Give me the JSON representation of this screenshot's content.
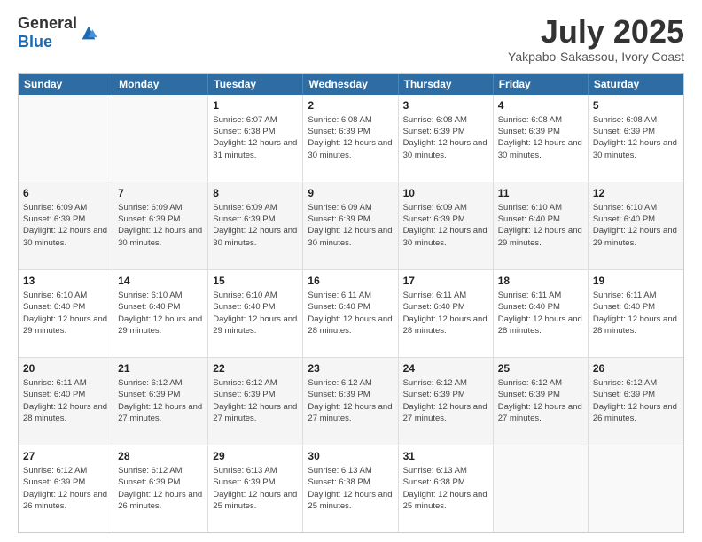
{
  "header": {
    "logo_general": "General",
    "logo_blue": "Blue",
    "title": "July 2025",
    "subtitle": "Yakpabo-Sakassou, Ivory Coast"
  },
  "calendar": {
    "weekdays": [
      "Sunday",
      "Monday",
      "Tuesday",
      "Wednesday",
      "Thursday",
      "Friday",
      "Saturday"
    ],
    "rows": [
      [
        {
          "day": "",
          "info": ""
        },
        {
          "day": "",
          "info": ""
        },
        {
          "day": "1",
          "info": "Sunrise: 6:07 AM\nSunset: 6:38 PM\nDaylight: 12 hours and 31 minutes."
        },
        {
          "day": "2",
          "info": "Sunrise: 6:08 AM\nSunset: 6:39 PM\nDaylight: 12 hours and 30 minutes."
        },
        {
          "day": "3",
          "info": "Sunrise: 6:08 AM\nSunset: 6:39 PM\nDaylight: 12 hours and 30 minutes."
        },
        {
          "day": "4",
          "info": "Sunrise: 6:08 AM\nSunset: 6:39 PM\nDaylight: 12 hours and 30 minutes."
        },
        {
          "day": "5",
          "info": "Sunrise: 6:08 AM\nSunset: 6:39 PM\nDaylight: 12 hours and 30 minutes."
        }
      ],
      [
        {
          "day": "6",
          "info": "Sunrise: 6:09 AM\nSunset: 6:39 PM\nDaylight: 12 hours and 30 minutes."
        },
        {
          "day": "7",
          "info": "Sunrise: 6:09 AM\nSunset: 6:39 PM\nDaylight: 12 hours and 30 minutes."
        },
        {
          "day": "8",
          "info": "Sunrise: 6:09 AM\nSunset: 6:39 PM\nDaylight: 12 hours and 30 minutes."
        },
        {
          "day": "9",
          "info": "Sunrise: 6:09 AM\nSunset: 6:39 PM\nDaylight: 12 hours and 30 minutes."
        },
        {
          "day": "10",
          "info": "Sunrise: 6:09 AM\nSunset: 6:39 PM\nDaylight: 12 hours and 30 minutes."
        },
        {
          "day": "11",
          "info": "Sunrise: 6:10 AM\nSunset: 6:40 PM\nDaylight: 12 hours and 29 minutes."
        },
        {
          "day": "12",
          "info": "Sunrise: 6:10 AM\nSunset: 6:40 PM\nDaylight: 12 hours and 29 minutes."
        }
      ],
      [
        {
          "day": "13",
          "info": "Sunrise: 6:10 AM\nSunset: 6:40 PM\nDaylight: 12 hours and 29 minutes."
        },
        {
          "day": "14",
          "info": "Sunrise: 6:10 AM\nSunset: 6:40 PM\nDaylight: 12 hours and 29 minutes."
        },
        {
          "day": "15",
          "info": "Sunrise: 6:10 AM\nSunset: 6:40 PM\nDaylight: 12 hours and 29 minutes."
        },
        {
          "day": "16",
          "info": "Sunrise: 6:11 AM\nSunset: 6:40 PM\nDaylight: 12 hours and 28 minutes."
        },
        {
          "day": "17",
          "info": "Sunrise: 6:11 AM\nSunset: 6:40 PM\nDaylight: 12 hours and 28 minutes."
        },
        {
          "day": "18",
          "info": "Sunrise: 6:11 AM\nSunset: 6:40 PM\nDaylight: 12 hours and 28 minutes."
        },
        {
          "day": "19",
          "info": "Sunrise: 6:11 AM\nSunset: 6:40 PM\nDaylight: 12 hours and 28 minutes."
        }
      ],
      [
        {
          "day": "20",
          "info": "Sunrise: 6:11 AM\nSunset: 6:40 PM\nDaylight: 12 hours and 28 minutes."
        },
        {
          "day": "21",
          "info": "Sunrise: 6:12 AM\nSunset: 6:39 PM\nDaylight: 12 hours and 27 minutes."
        },
        {
          "day": "22",
          "info": "Sunrise: 6:12 AM\nSunset: 6:39 PM\nDaylight: 12 hours and 27 minutes."
        },
        {
          "day": "23",
          "info": "Sunrise: 6:12 AM\nSunset: 6:39 PM\nDaylight: 12 hours and 27 minutes."
        },
        {
          "day": "24",
          "info": "Sunrise: 6:12 AM\nSunset: 6:39 PM\nDaylight: 12 hours and 27 minutes."
        },
        {
          "day": "25",
          "info": "Sunrise: 6:12 AM\nSunset: 6:39 PM\nDaylight: 12 hours and 27 minutes."
        },
        {
          "day": "26",
          "info": "Sunrise: 6:12 AM\nSunset: 6:39 PM\nDaylight: 12 hours and 26 minutes."
        }
      ],
      [
        {
          "day": "27",
          "info": "Sunrise: 6:12 AM\nSunset: 6:39 PM\nDaylight: 12 hours and 26 minutes."
        },
        {
          "day": "28",
          "info": "Sunrise: 6:12 AM\nSunset: 6:39 PM\nDaylight: 12 hours and 26 minutes."
        },
        {
          "day": "29",
          "info": "Sunrise: 6:13 AM\nSunset: 6:39 PM\nDaylight: 12 hours and 25 minutes."
        },
        {
          "day": "30",
          "info": "Sunrise: 6:13 AM\nSunset: 6:38 PM\nDaylight: 12 hours and 25 minutes."
        },
        {
          "day": "31",
          "info": "Sunrise: 6:13 AM\nSunset: 6:38 PM\nDaylight: 12 hours and 25 minutes."
        },
        {
          "day": "",
          "info": ""
        },
        {
          "day": "",
          "info": ""
        }
      ]
    ]
  }
}
